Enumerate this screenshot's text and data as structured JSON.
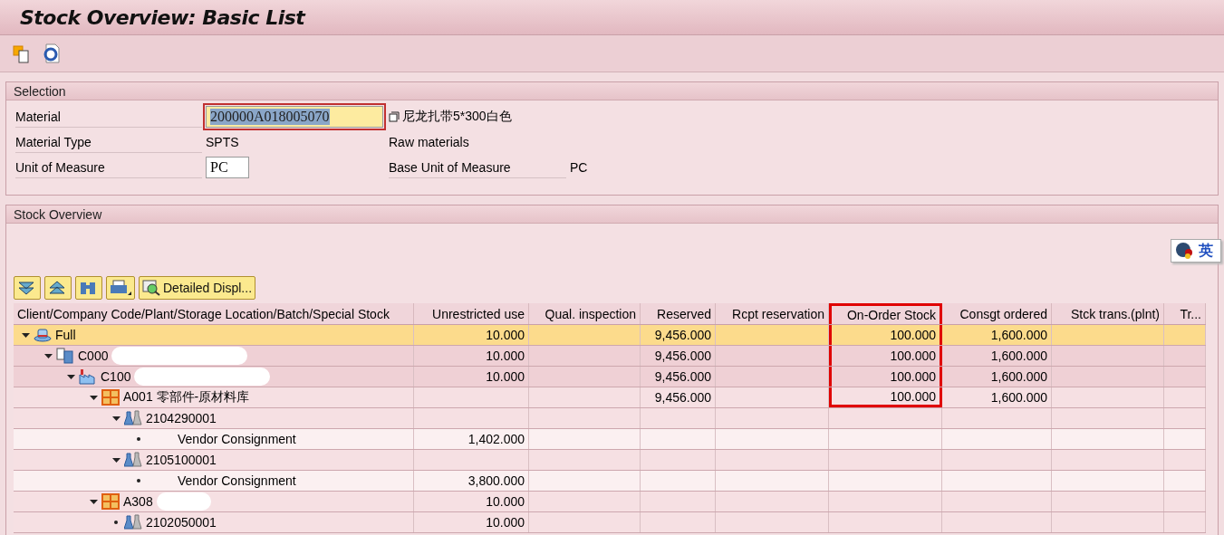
{
  "window": {
    "title": "Stock Overview: Basic List"
  },
  "toolbar": {
    "buttons": [
      {
        "kind": "copy"
      },
      {
        "kind": "refresh"
      }
    ]
  },
  "selection": {
    "title": "Selection",
    "material": {
      "label": "Material",
      "value": "200000A018005070",
      "focused": true,
      "text_selected": true,
      "description": "尼龙扎带5*300白色"
    },
    "material_type": {
      "label": "Material Type",
      "value": "SPTS",
      "description": "Raw materials"
    },
    "unit": {
      "label": "Unit of Measure",
      "value": "PC",
      "base_label": "Base Unit of Measure",
      "base_value": "PC"
    }
  },
  "ime_badge": {
    "text": "英"
  },
  "stock": {
    "title": "Stock Overview",
    "grid_toolbar": [
      {
        "kind": "expand"
      },
      {
        "kind": "collapse"
      },
      {
        "kind": "find"
      },
      {
        "kind": "print"
      },
      {
        "kind": "detail",
        "label": "Detailed Displ..."
      }
    ],
    "columns": [
      {
        "label": "Client/Company Code/Plant/Storage Location/Batch/Special Stock",
        "highlighted": false
      },
      {
        "label": "Unrestricted use",
        "highlighted": false
      },
      {
        "label": "Qual. inspection",
        "highlighted": false
      },
      {
        "label": "Reserved",
        "highlighted": false
      },
      {
        "label": "Rcpt reservation",
        "highlighted": false
      },
      {
        "label": "On-Order Stock",
        "highlighted": true
      },
      {
        "label": "Consgt ordered",
        "highlighted": false
      },
      {
        "label": "Stck trans.(plnt)",
        "highlighted": false
      },
      {
        "label": "Tr...",
        "highlighted": false
      }
    ],
    "rows": [
      {
        "kind": "total",
        "label": "Full",
        "redacted": false,
        "selected": true,
        "expanded": true,
        "highlighted": true,
        "unrestricted_use": "10.000",
        "reserved": "9,456.000",
        "on_order_stock": "100.000",
        "consgt_ordered": "1,600.000",
        "children": [
          {
            "kind": "company",
            "label": "C000",
            "redacted": true,
            "selected": false,
            "expanded": true,
            "highlighted": true,
            "unrestricted_use": "10.000",
            "reserved": "9,456.000",
            "on_order_stock": "100.000",
            "consgt_ordered": "1,600.000",
            "children": [
              {
                "kind": "plant",
                "label": "C100",
                "redacted": true,
                "selected": false,
                "expanded": true,
                "highlighted": true,
                "unrestricted_use": "10.000",
                "reserved": "9,456.000",
                "on_order_stock": "100.000",
                "consgt_ordered": "1,600.000",
                "children": [
                  {
                    "kind": "storage",
                    "label": "A001 零部件-原材料库",
                    "redacted": false,
                    "selected": false,
                    "expanded": true,
                    "highlighted": true,
                    "reserved": "9,456.000",
                    "on_order_stock": "100.000",
                    "consgt_ordered": "1,600.000",
                    "children": [
                      {
                        "kind": "batch",
                        "label": "2104290001",
                        "redacted": false,
                        "selected": false,
                        "expanded": true,
                        "highlighted": false,
                        "children": [
                          {
                            "kind": "special",
                            "label": "Vendor Consignment",
                            "redacted": false,
                            "selected": false,
                            "expanded": false,
                            "highlighted": false,
                            "unrestricted_use": "1,402.000"
                          }
                        ]
                      },
                      {
                        "kind": "batch",
                        "label": "2105100001",
                        "redacted": false,
                        "selected": false,
                        "expanded": true,
                        "highlighted": false,
                        "children": [
                          {
                            "kind": "special",
                            "label": "Vendor Consignment",
                            "redacted": false,
                            "selected": false,
                            "expanded": false,
                            "highlighted": false,
                            "unrestricted_use": "3,800.000"
                          }
                        ]
                      }
                    ]
                  },
                  {
                    "kind": "storage",
                    "label": "A308",
                    "redacted": true,
                    "selected": false,
                    "expanded": true,
                    "highlighted": false,
                    "unrestricted_use": "10.000",
                    "children": [
                      {
                        "kind": "batch",
                        "label": "2102050001",
                        "redacted": false,
                        "selected": false,
                        "expanded": false,
                        "highlighted": false,
                        "unrestricted_use": "10.000"
                      }
                    ]
                  }
                ]
              }
            ]
          }
        ]
      }
    ]
  }
}
